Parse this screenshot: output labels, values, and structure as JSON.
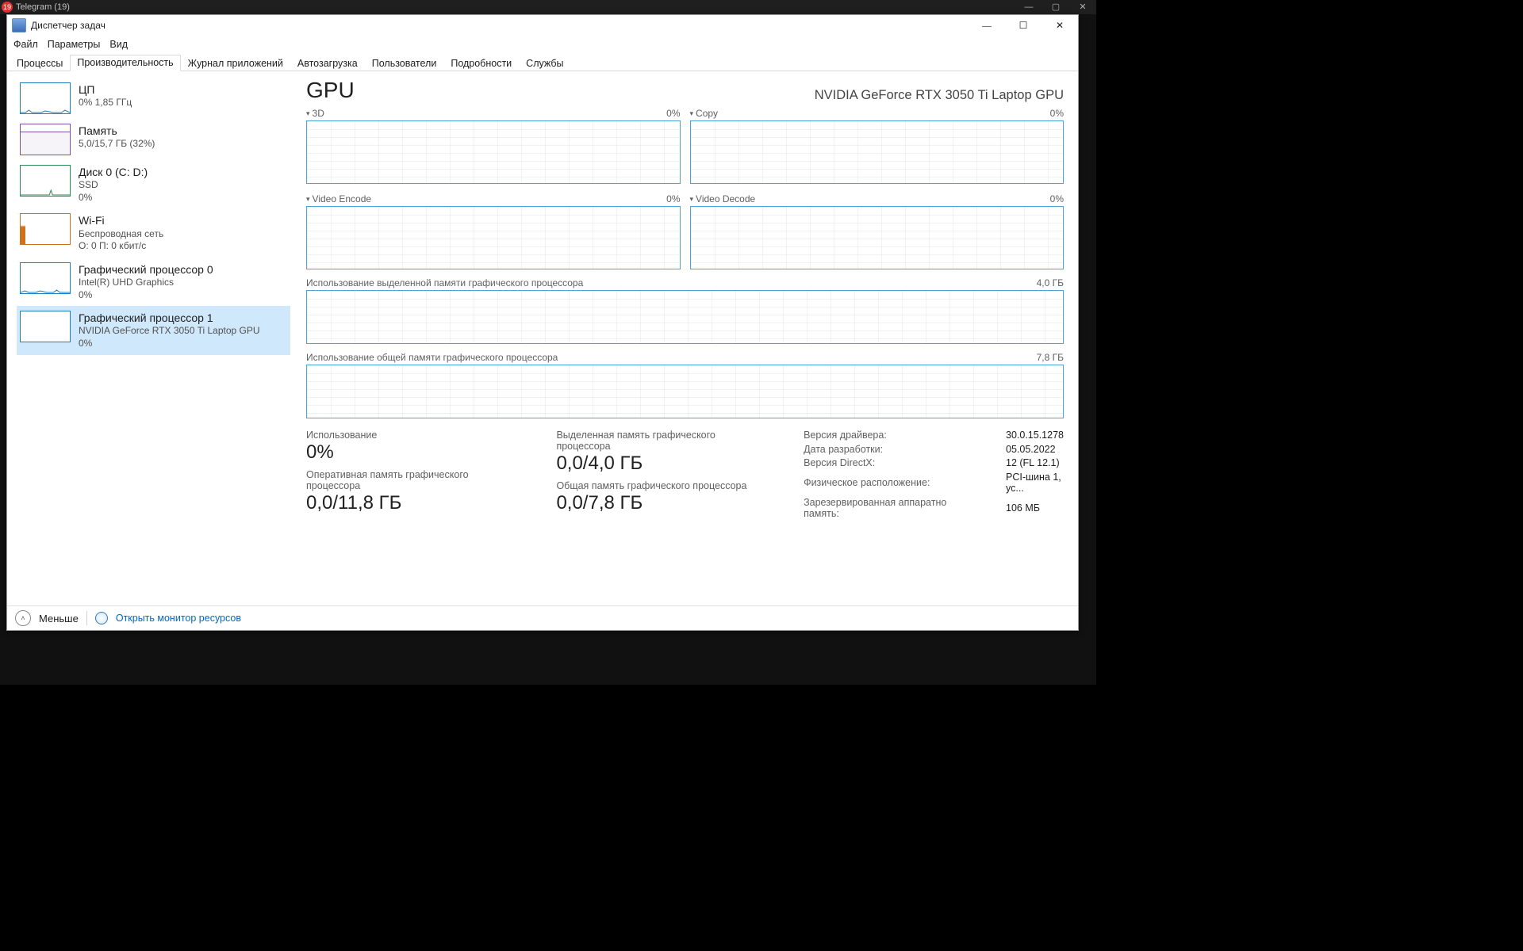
{
  "desktop": {
    "bg_window_title": "Telegram (19)",
    "bg_badge": "19"
  },
  "window": {
    "title": "Диспетчер задач"
  },
  "menu": {
    "file": "Файл",
    "options": "Параметры",
    "view": "Вид"
  },
  "tabs": {
    "processes": "Процессы",
    "performance": "Производительность",
    "app_history": "Журнал приложений",
    "startup": "Автозагрузка",
    "users": "Пользователи",
    "details": "Подробности",
    "services": "Службы"
  },
  "sidebar": {
    "items": [
      {
        "title": "ЦП",
        "sub1": "0%  1,85 ГГц"
      },
      {
        "title": "Память",
        "sub1": "5,0/15,7 ГБ (32%)"
      },
      {
        "title": "Диск 0 (C: D:)",
        "sub1": "SSD",
        "sub2": "0%"
      },
      {
        "title": "Wi-Fi",
        "sub1": "Беспроводная сеть",
        "sub2": "О: 0  П: 0 кбит/с"
      },
      {
        "title": "Графический процессор 0",
        "sub1": "Intel(R) UHD Graphics",
        "sub2": "0%"
      },
      {
        "title": "Графический процессор 1",
        "sub1": "NVIDIA GeForce RTX 3050 Ti Laptop GPU",
        "sub2": "0%"
      }
    ]
  },
  "main": {
    "title": "GPU",
    "device": "NVIDIA GeForce RTX 3050 Ti Laptop GPU",
    "graphs": {
      "g1_label": "3D",
      "g1_pct": "0%",
      "g2_label": "Copy",
      "g2_pct": "0%",
      "g3_label": "Video Encode",
      "g3_pct": "0%",
      "g4_label": "Video Decode",
      "g4_pct": "0%"
    },
    "wide1_label": "Использование выделенной памяти графического процессора",
    "wide1_max": "4,0 ГБ",
    "wide2_label": "Использование общей памяти графического процессора",
    "wide2_max": "7,8 ГБ",
    "stats": {
      "usage_label": "Использование",
      "usage_value": "0%",
      "dedicated_label": "Выделенная память графического процессора",
      "dedicated_value": "0,0/4,0 ГБ",
      "gpu_ram_label": "Оперативная память графического процессора",
      "gpu_ram_value": "0,0/11,8 ГБ",
      "shared_label": "Общая память графического процессора",
      "shared_value": "0,0/7,8 ГБ"
    },
    "info": {
      "driver_ver_k": "Версия драйвера:",
      "driver_ver_v": "30.0.15.1278",
      "driver_date_k": "Дата разработки:",
      "driver_date_v": "05.05.2022",
      "dx_k": "Версия DirectX:",
      "dx_v": "12 (FL 12.1)",
      "loc_k": "Физическое расположение:",
      "loc_v": "PCI-шина 1, ус...",
      "reserved_k": "Зарезервированная аппаратно память:",
      "reserved_v": "106 МБ"
    }
  },
  "footer": {
    "fewer": "Меньше",
    "open_resmon": "Открыть монитор ресурсов"
  }
}
